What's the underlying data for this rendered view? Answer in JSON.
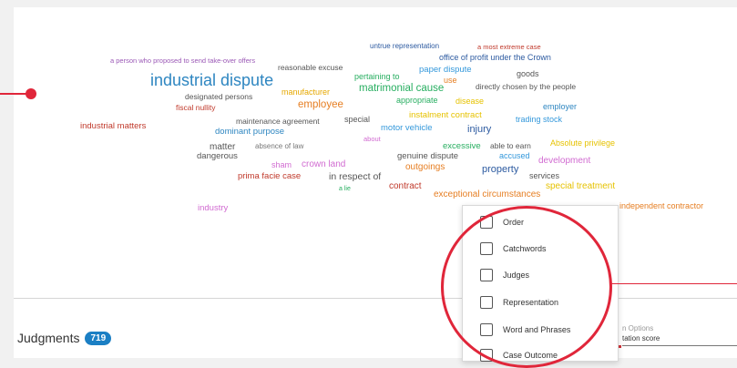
{
  "word_cloud": {
    "words": [
      {
        "text": "a person who proposed to send take-over offers",
        "color": "#9b59b6"
      },
      {
        "text": "untrue representation",
        "color": "#2c5aa0"
      },
      {
        "text": "a most extreme case",
        "color": "#c0392b"
      },
      {
        "text": "office of profit under the Crown",
        "color": "#2c5aa0"
      },
      {
        "text": "reasonable excuse",
        "color": "#555555"
      },
      {
        "text": "paper dispute",
        "color": "#3498db"
      },
      {
        "text": "industrial dispute",
        "color": "#2e86c1"
      },
      {
        "text": "pertaining to",
        "color": "#27ae60"
      },
      {
        "text": "goods",
        "color": "#555555"
      },
      {
        "text": "use",
        "color": "#e67e22"
      },
      {
        "text": "directly chosen by the people",
        "color": "#555555"
      },
      {
        "text": "matrimonial cause",
        "color": "#27ae60"
      },
      {
        "text": "manufacturer",
        "color": "#e6a800"
      },
      {
        "text": "designated persons",
        "color": "#555555"
      },
      {
        "text": "appropriate",
        "color": "#27ae60"
      },
      {
        "text": "disease",
        "color": "#e6c200"
      },
      {
        "text": "fiscal nullity",
        "color": "#c0392b"
      },
      {
        "text": "employee",
        "color": "#e67e22"
      },
      {
        "text": "employer",
        "color": "#2e86c1"
      },
      {
        "text": "instalment contract",
        "color": "#e6c200"
      },
      {
        "text": "maintenance agreement",
        "color": "#555555"
      },
      {
        "text": "special",
        "color": "#555555"
      },
      {
        "text": "trading stock",
        "color": "#3498db"
      },
      {
        "text": "industrial matters",
        "color": "#c0392b"
      },
      {
        "text": "dominant purpose",
        "color": "#2e86c1"
      },
      {
        "text": "motor vehicle",
        "color": "#3498db"
      },
      {
        "text": "injury",
        "color": "#2c5aa0"
      },
      {
        "text": "about",
        "color": "#d16bd1"
      },
      {
        "text": "matter",
        "color": "#555555"
      },
      {
        "text": "absence of law",
        "color": "#777777"
      },
      {
        "text": "excessive",
        "color": "#27ae60"
      },
      {
        "text": "able to earn",
        "color": "#555555"
      },
      {
        "text": "Absolute privilege",
        "color": "#e6c200"
      },
      {
        "text": "dangerous",
        "color": "#555555"
      },
      {
        "text": "genuine dispute",
        "color": "#555555"
      },
      {
        "text": "accused",
        "color": "#3498db"
      },
      {
        "text": "sham",
        "color": "#d16bd1"
      },
      {
        "text": "crown land",
        "color": "#d16bd1"
      },
      {
        "text": "development",
        "color": "#d16bd1"
      },
      {
        "text": "outgoings",
        "color": "#e67e22"
      },
      {
        "text": "property",
        "color": "#2c5aa0"
      },
      {
        "text": "prima facie case",
        "color": "#c0392b"
      },
      {
        "text": "in respect of",
        "color": "#555555"
      },
      {
        "text": "services",
        "color": "#555555"
      },
      {
        "text": "contract",
        "color": "#c0392b"
      },
      {
        "text": "special treatment",
        "color": "#e6c200"
      },
      {
        "text": "a lie",
        "color": "#27ae60"
      },
      {
        "text": "exceptional circumstances",
        "color": "#e67e22"
      },
      {
        "text": "independent contractor",
        "color": "#e67e22"
      },
      {
        "text": "industry",
        "color": "#d16bd1"
      }
    ]
  },
  "judgments": {
    "label": "Judgments",
    "count": "719"
  },
  "sort": {
    "caption": "n Options",
    "value": "tation score"
  },
  "filter_menu": {
    "options": [
      {
        "label": "Order"
      },
      {
        "label": "Catchwords"
      },
      {
        "label": "Judges"
      },
      {
        "label": "Representation"
      },
      {
        "label": "Word and Phrases"
      },
      {
        "label": "Case Outcome"
      }
    ]
  },
  "annotation": {
    "color": "#e0263a"
  }
}
